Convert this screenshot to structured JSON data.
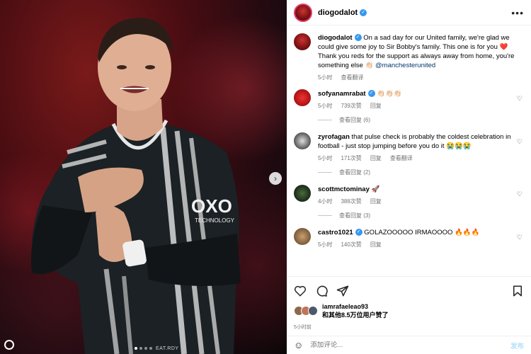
{
  "post": {
    "author": "diogodalot",
    "verified": true,
    "caption_text": "On a sad day for our United family, we're glad we could give some joy to Sir Bobby's family. This one is for you ❤️ Thank you reds for the support as always away from home, you're something else 👏🏻 ",
    "caption_mention": "@manchesterunited",
    "caption_time": "5小时",
    "translate_label": "查看翻译",
    "photo_tag": "EAT.RDY"
  },
  "comments": [
    {
      "username": "sofyanamrabat",
      "verified": true,
      "text": "👏🏻👏🏻👏🏻",
      "time": "5小时",
      "likes": "739次赞",
      "reply_label": "回复",
      "replies_label": "查看回复 (6)"
    },
    {
      "username": "zyrofagan",
      "verified": false,
      "text": "that pulse check is probably the coldest celebration in football - just stop jumping before you do it 😭😭😭",
      "time": "5小时",
      "likes": "171次赞",
      "reply_label": "回复",
      "translate_label": "查看翻译",
      "replies_label": "查看回复 (2)"
    },
    {
      "username": "scottmctominay",
      "verified": false,
      "text": "🚀",
      "time": "4小时",
      "likes": "388次赞",
      "reply_label": "回复",
      "replies_label": "查看回复 (3)"
    },
    {
      "username": "castro1021",
      "verified": true,
      "text": "GOLAZOOOOO IRMAOOOO 🔥🔥🔥",
      "time": "5小时",
      "likes": "140次赞",
      "reply_label": "回复"
    }
  ],
  "likes": {
    "first_user": "iamrafaeleao93",
    "others_text": "和其他8.5万位用户赞了",
    "date": "5小时前"
  },
  "add_comment": {
    "placeholder": "添加评论...",
    "post_label": "发布"
  },
  "icons": [
    "heart-icon",
    "comment-icon",
    "share-icon",
    "bookmark-icon",
    "emoji-icon",
    "more-icon",
    "chevron-right-icon"
  ]
}
